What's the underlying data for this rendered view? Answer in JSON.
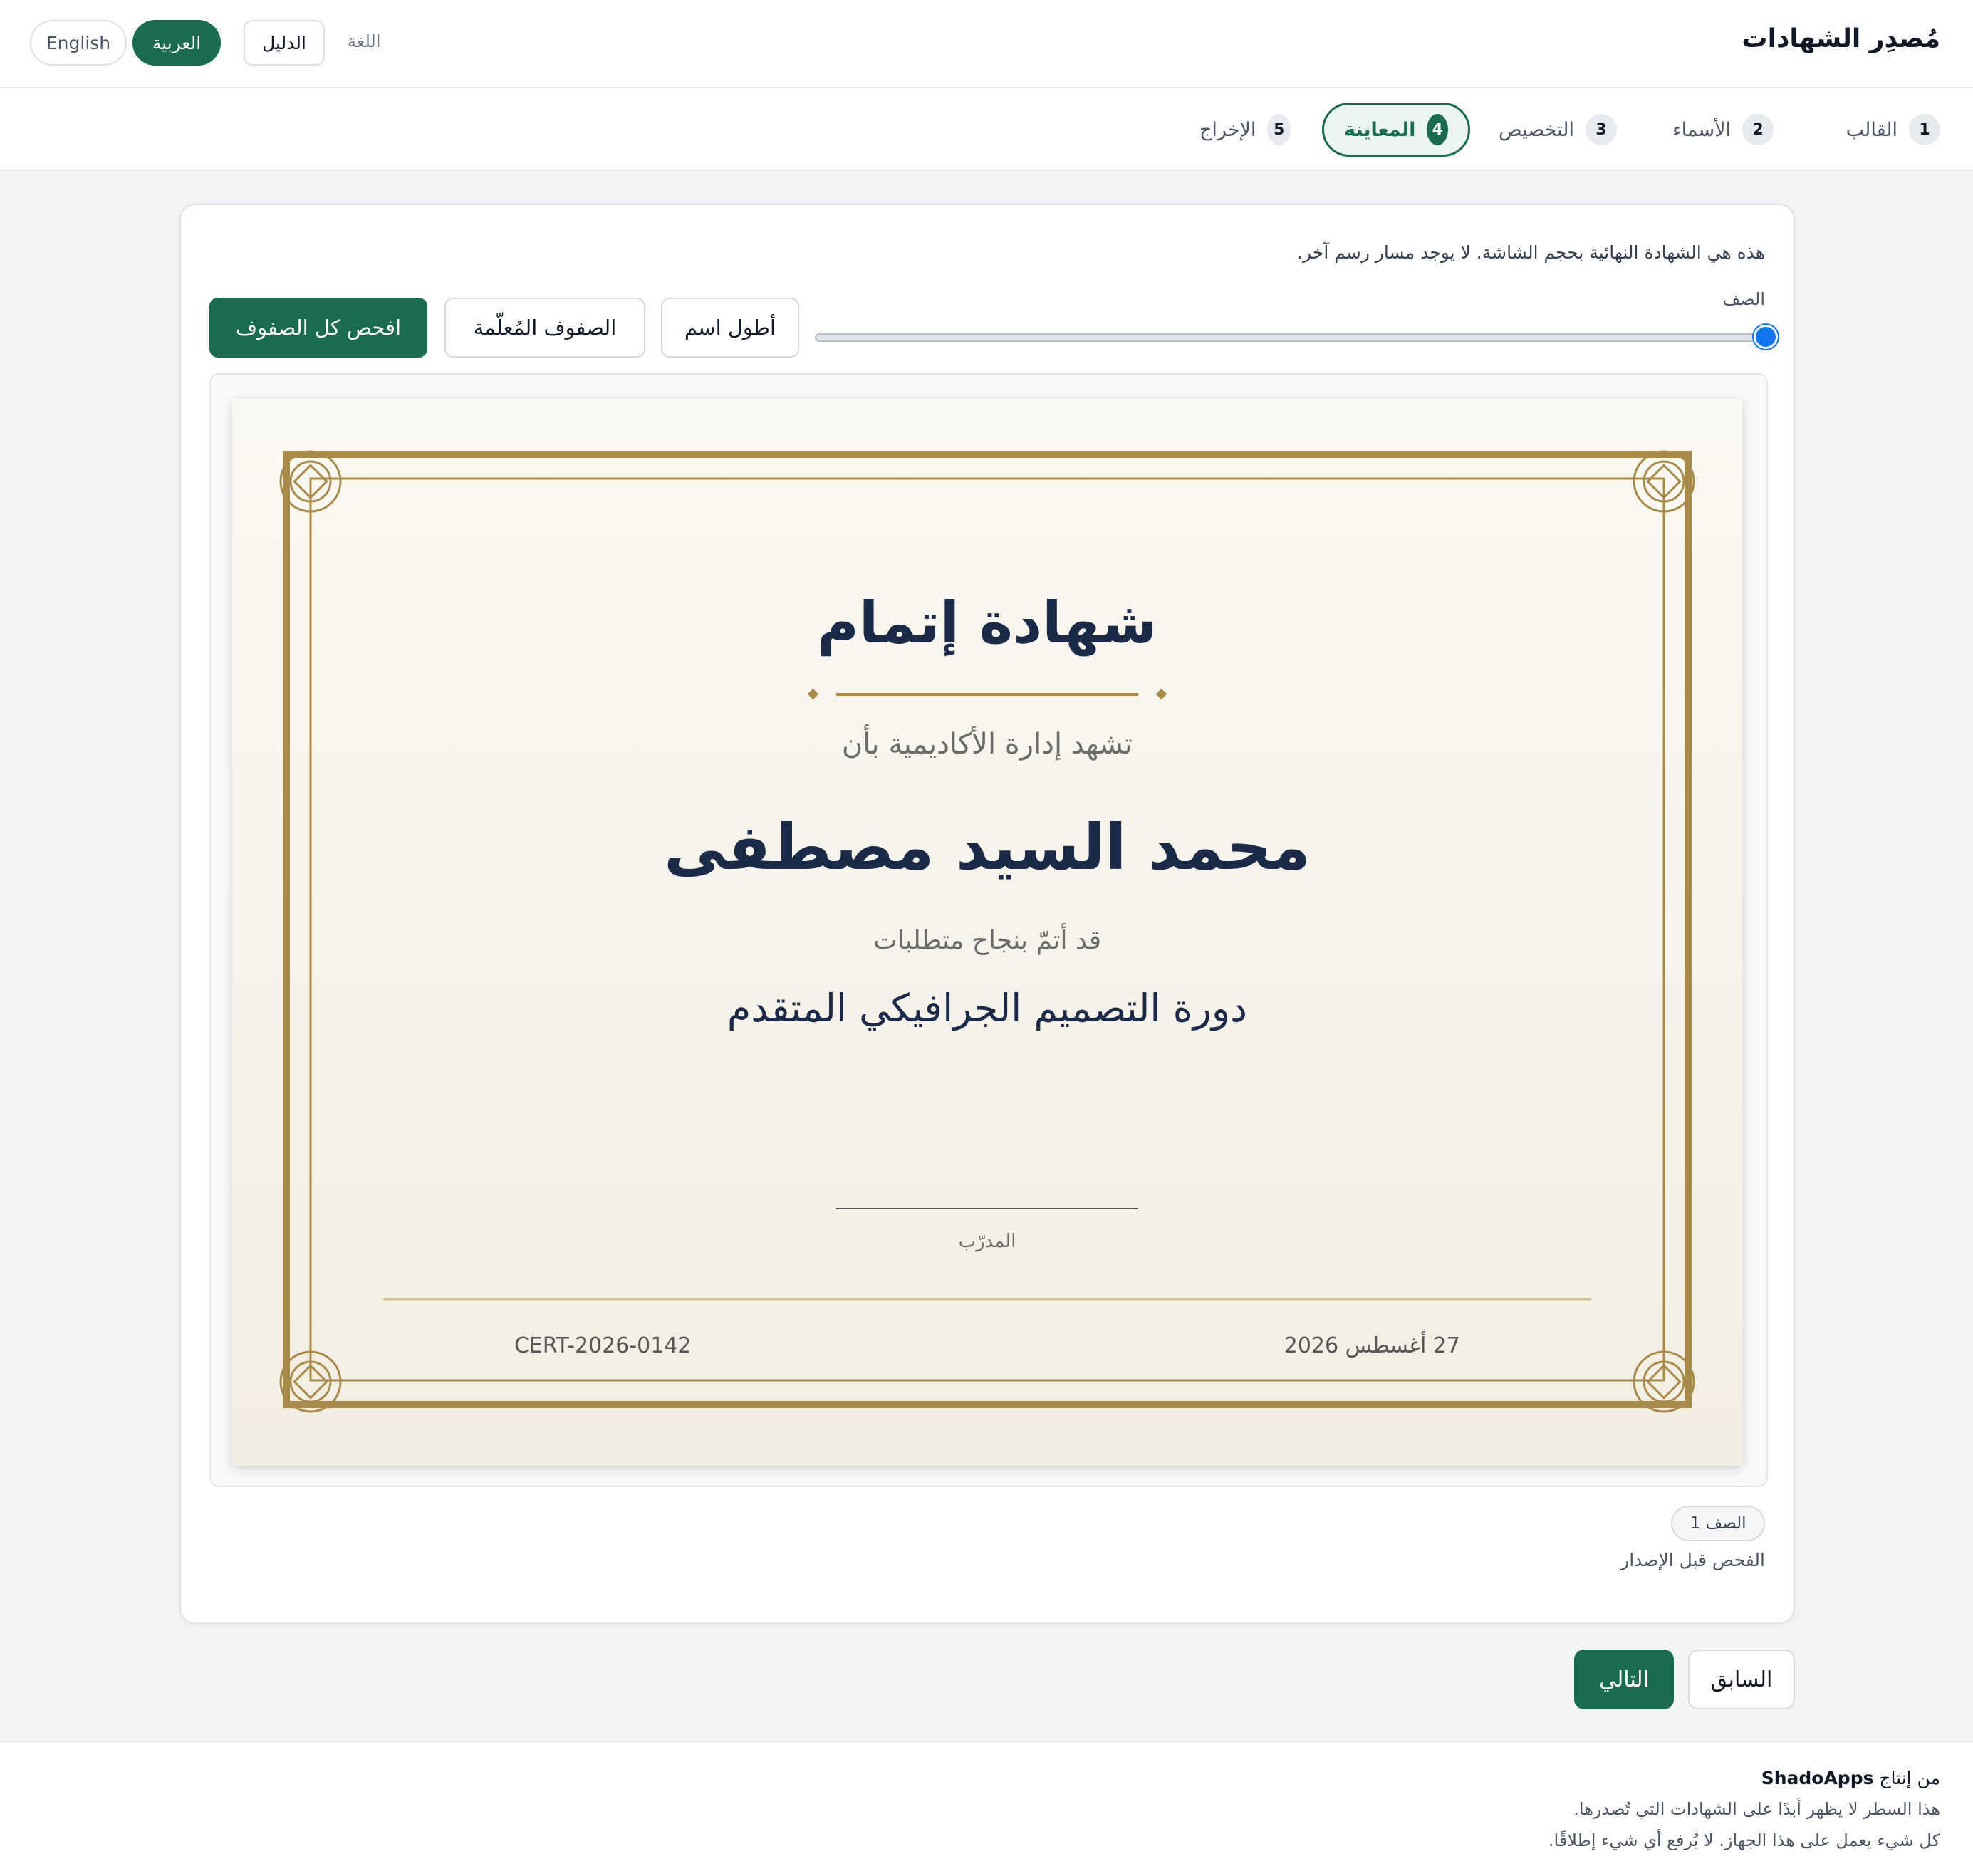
{
  "header": {
    "app_title": "مُصدِر الشهادات",
    "language_label": "اللغة",
    "guide_label": "الدليل",
    "lang_arabic": "العربية",
    "lang_english": "English"
  },
  "steps": [
    {
      "num": "1",
      "label": "القالب"
    },
    {
      "num": "2",
      "label": "الأسماء"
    },
    {
      "num": "3",
      "label": "التخصيص"
    },
    {
      "num": "4",
      "label": "المعاينة",
      "active": true
    },
    {
      "num": "5",
      "label": "الإخراج"
    }
  ],
  "preview": {
    "hint": "هذه هي الشهادة النهائية بحجم الشاشة. لا يوجد مسار رسم آخر.",
    "row_label": "الصف",
    "row_slider_value": 1,
    "btn_longest_name": "أطول اسم",
    "btn_flagged_rows": "الصفوف المُعلّمة",
    "btn_check_all": "افحص كل الصفوف",
    "row_badge": "الصف 1",
    "precheck_label": "الفحص قبل الإصدار"
  },
  "certificate": {
    "title": "شهادة إتمام",
    "subtitle": "تشهد إدارة الأكاديمية بأن",
    "recipient": "محمد السيد مصطفى",
    "completed_text": "قد أتمّ بنجاح متطلبات",
    "course": "دورة التصميم الجرافيكي المتقدم",
    "trainer_label": "المدرّب",
    "date": "27 أغسطس 2026",
    "cert_id": "CERT-2026-0142",
    "colors": {
      "gold": "#a88a4a",
      "navy": "#1c2a4a",
      "paper": "#f6f3ea"
    }
  },
  "nav": {
    "prev_label": "السابق",
    "next_label": "التالي"
  },
  "footer": {
    "made_by_prefix": "من إنتاج",
    "made_by_brand": "ShadoApps",
    "line2": "هذا السطر لا يظهر أبدًا على الشهادات التي تُصدرها.",
    "line3": "كل شيء يعمل على هذا الجهاز. لا يُرفع أي شيء إطلاقًا."
  },
  "theme": {
    "accent": "#1b6b50",
    "slider": "#1277ee"
  }
}
